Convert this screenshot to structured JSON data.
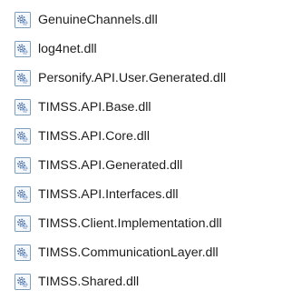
{
  "files": [
    {
      "name": "GenuineChannels.dll",
      "icon": "dll-file-icon"
    },
    {
      "name": "log4net.dll",
      "icon": "dll-file-icon"
    },
    {
      "name": "Personify.API.User.Generated.dll",
      "icon": "dll-file-icon"
    },
    {
      "name": "TIMSS.API.Base.dll",
      "icon": "dll-file-icon"
    },
    {
      "name": "TIMSS.API.Core.dll",
      "icon": "dll-file-icon"
    },
    {
      "name": "TIMSS.API.Generated.dll",
      "icon": "dll-file-icon"
    },
    {
      "name": "TIMSS.API.Interfaces.dll",
      "icon": "dll-file-icon"
    },
    {
      "name": "TIMSS.Client.Implementation.dll",
      "icon": "dll-file-icon"
    },
    {
      "name": "TIMSS.CommunicationLayer.dll",
      "icon": "dll-file-icon"
    },
    {
      "name": "TIMSS.Shared.dll",
      "icon": "dll-file-icon"
    }
  ],
  "colors": {
    "text": "#1e1e1e",
    "icon_border": "#7f9db9",
    "icon_fill": "#ffffff",
    "gear": "#4a6fa5"
  }
}
